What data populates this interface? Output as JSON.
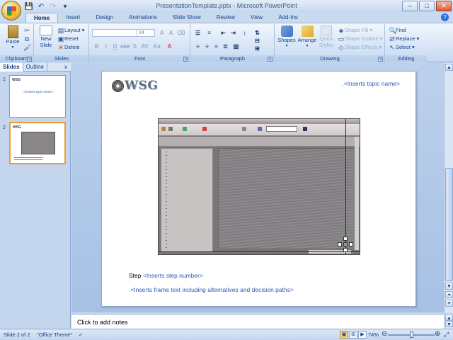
{
  "window": {
    "title": "PresentationTemplate.pptx - Microsoft PowerPoint",
    "controls": {
      "minimize": "–",
      "maximize": "□",
      "close": "✕"
    }
  },
  "qat": {
    "save_icon": "💾",
    "undo_icon": "↶",
    "redo_icon": "↷",
    "customize": "▾"
  },
  "tabs": [
    "Home",
    "Insert",
    "Design",
    "Animations",
    "Slide Show",
    "Review",
    "View",
    "Add-Ins"
  ],
  "ribbon": {
    "clipboard": {
      "label": "Clipboard",
      "paste": "Paste"
    },
    "slides": {
      "label": "Slides",
      "new_slide_line1": "New",
      "new_slide_line2": "Slide",
      "layout": "Layout",
      "reset": "Reset",
      "delete": "Delete"
    },
    "font": {
      "label": "Font",
      "font_name": "",
      "font_size": "14"
    },
    "paragraph": {
      "label": "Paragraph"
    },
    "drawing": {
      "label": "Drawing",
      "shapes": "Shapes",
      "arrange": "Arrange",
      "quick_styles_line1": "Quick",
      "quick_styles_line2": "Styles",
      "shape_fill": "Shape Fill",
      "shape_outline": "Shape Outline",
      "shape_effects": "Shape Effects"
    },
    "editing": {
      "label": "Editing",
      "find": "Find",
      "replace": "Replace",
      "select": "Select"
    }
  },
  "panel": {
    "tab_slides": "Slides",
    "tab_outline": "Outline",
    "close": "x",
    "thumb1_num": "1",
    "thumb2_num": "2",
    "thumb1_topic": ".<Inserts topic name>"
  },
  "slide": {
    "logo_text": "WSG",
    "topic": ".<Inserts topic name>",
    "step_label": "Step ",
    "step_value": "<Inserts step number>",
    "frame_text": ".<Inserts frame text including alternatives and decision paths>"
  },
  "notes": {
    "placeholder": "Click to add notes"
  },
  "status": {
    "slide_count": "Slide 2 of 2",
    "theme": "\"Office Theme\"",
    "zoom": "74%"
  }
}
